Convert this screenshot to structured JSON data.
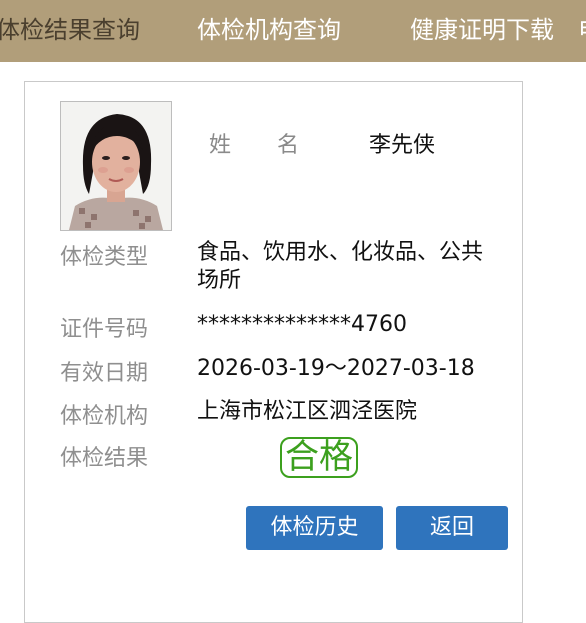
{
  "nav": {
    "items": [
      "体检结果查询",
      "体检机构查询",
      "健康证明下载",
      "电"
    ]
  },
  "person": {
    "name_label_1": "姓",
    "name_label_2": "名",
    "name": "李先侠"
  },
  "rows": {
    "exam_type_label": "体检类型",
    "exam_type_value": "食品、饮用水、化妆品、公共场所",
    "id_label": "证件号码",
    "id_value": "**************4760",
    "valid_label": "有效日期",
    "valid_value": "2026-03-19～2027-03-18",
    "org_label": "体检机构",
    "org_value": "上海市松江区泗泾医院",
    "result_label": "体检结果",
    "result_value": "合格"
  },
  "buttons": {
    "history": "体检历史",
    "back": "返回"
  },
  "colors": {
    "nav_bg": "#b19e7a",
    "button_bg": "#2f74bd",
    "pass_green": "#3ca01e"
  }
}
